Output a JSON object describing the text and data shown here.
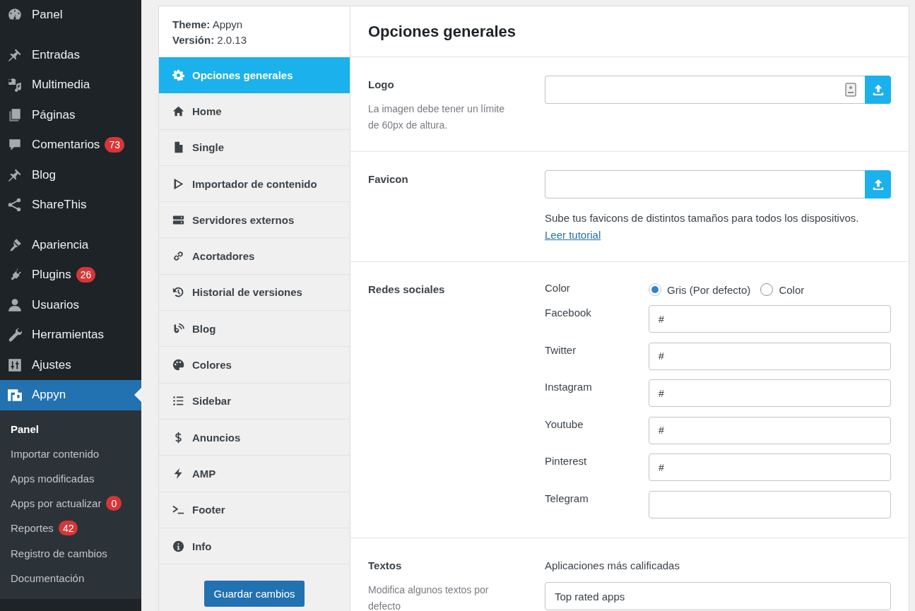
{
  "admin_menu": {
    "groups": [
      [
        {
          "label": "Panel",
          "selected": false
        }
      ],
      [
        {
          "label": "Entradas",
          "selected": false
        },
        {
          "label": "Multimedia",
          "selected": false
        },
        {
          "label": "Páginas",
          "selected": false
        },
        {
          "label": "Comentarios",
          "selected": false,
          "badge": "73"
        },
        {
          "label": "Blog",
          "selected": false
        },
        {
          "label": "ShareThis",
          "selected": false
        }
      ],
      [
        {
          "label": "Apariencia",
          "selected": false
        },
        {
          "label": "Plugins",
          "selected": false,
          "badge": "26"
        },
        {
          "label": "Usuarios",
          "selected": false
        },
        {
          "label": "Herramientas",
          "selected": false
        },
        {
          "label": "Ajustes",
          "selected": false
        },
        {
          "label": "Appyn",
          "selected": true,
          "submenu": [
            {
              "label": "Panel",
              "selected": true
            },
            {
              "label": "Importar contenido",
              "selected": false
            },
            {
              "label": "Apps modificadas",
              "selected": false
            },
            {
              "label": "Apps por actualizar",
              "selected": false,
              "badge": "0"
            },
            {
              "label": "Reportes",
              "selected": false,
              "badge": "42"
            },
            {
              "label": "Registro de cambios",
              "selected": false
            },
            {
              "label": "Documentación",
              "selected": false
            }
          ]
        }
      ]
    ]
  },
  "settings_nav": {
    "header": [
      "**Theme:** Appyn",
      "**Versión:** 2.0.13"
    ],
    "items": [
      {
        "label": "Opciones generales",
        "selected": true
      },
      {
        "label": "Home",
        "selected": false
      },
      {
        "label": "Single",
        "selected": false
      },
      {
        "label": "Importador de contenido",
        "selected": false
      },
      {
        "label": "Servidores externos",
        "selected": false
      },
      {
        "label": "Acortadores",
        "selected": false
      },
      {
        "label": "Historial de versiones",
        "selected": false
      },
      {
        "label": "Blog",
        "selected": false
      },
      {
        "label": "Colores",
        "selected": false
      },
      {
        "label": "Sidebar",
        "selected": false
      },
      {
        "label": "Anuncios",
        "selected": false
      },
      {
        "label": "AMP",
        "selected": false
      },
      {
        "label": "Footer",
        "selected": false
      },
      {
        "label": "Info",
        "selected": false
      }
    ],
    "save_button": "Guardar cambios"
  },
  "content": {
    "title": "Opciones generales",
    "sections": [
      {
        "kind": "upload",
        "label": "Logo",
        "description": "La imagen debe tener un límite de 60px de altura.",
        "autofill": true
      },
      {
        "kind": "upload",
        "label": "Favicon",
        "autofill": false,
        "help": "Sube tus favicons de distintos tamaños para todos los dispositivos.",
        "link": "Leer tutorial"
      },
      {
        "kind": "social",
        "label": "Redes sociales",
        "color_option": {
          "label": "Color",
          "options": [
            {
              "label": "Gris (Por defecto)",
              "selected": true
            },
            {
              "label": "Color",
              "selected": false
            }
          ]
        },
        "links": [
          {
            "label": "Facebook",
            "value": "#"
          },
          {
            "label": "Twitter",
            "value": "#"
          },
          {
            "label": "Instagram",
            "value": "#"
          },
          {
            "label": "Youtube",
            "value": "#"
          },
          {
            "label": "Pinterest",
            "value": "#"
          },
          {
            "label": "Telegram"
          }
        ]
      },
      {
        "kind": "texts",
        "label": "Textos",
        "description": "Modifica algunos textos por defecto",
        "fields": [
          {
            "label": "Aplicaciones más calificadas",
            "value": "Top rated apps"
          }
        ]
      }
    ]
  }
}
